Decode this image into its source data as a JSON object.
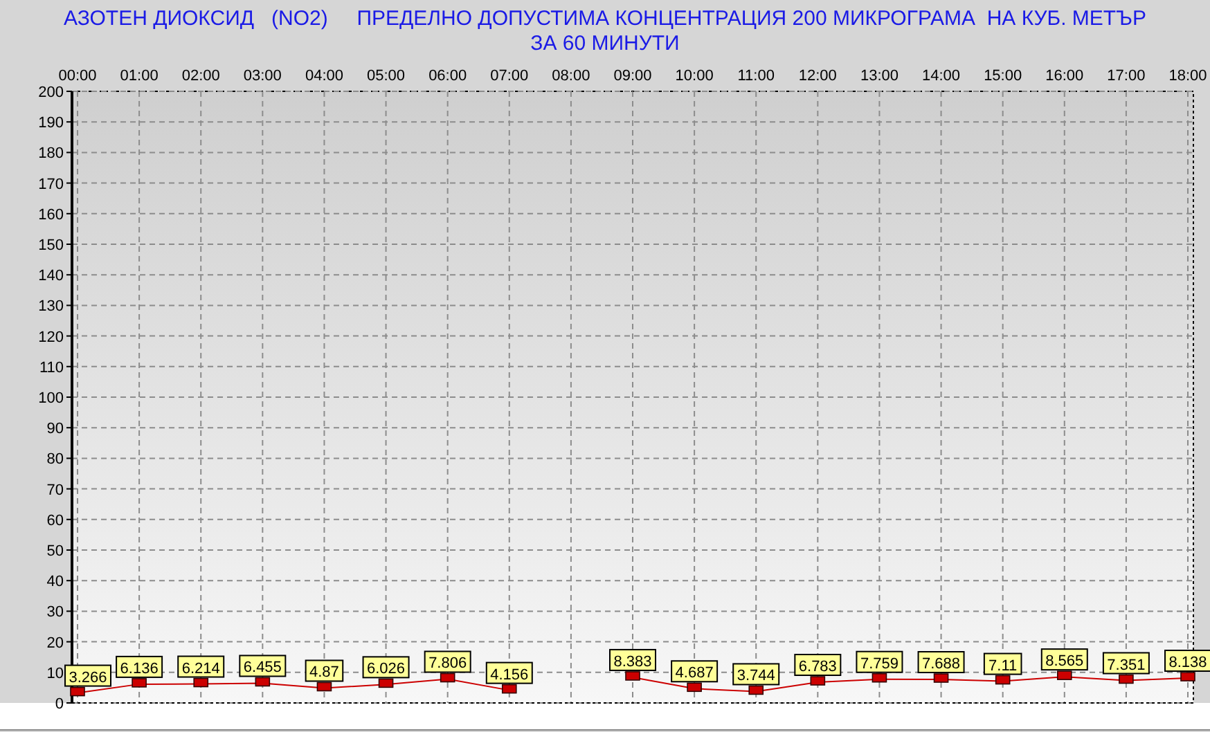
{
  "header": {
    "title": "АЗОТЕН ДИОКСИД   (NO2)     ПРЕДЕЛНО ДОПУСТИМА КОНЦЕНТРАЦИЯ 200 МИКРОГРАМА  НА КУБ. МЕТЪР",
    "subtitle": "ЗА 60 МИНУТИ"
  },
  "chart_data": {
    "type": "line",
    "categories": [
      "00:00",
      "01:00",
      "02:00",
      "03:00",
      "04:00",
      "05:00",
      "06:00",
      "07:00",
      "08:00",
      "09:00",
      "10:00",
      "11:00",
      "12:00",
      "13:00",
      "14:00",
      "15:00",
      "16:00",
      "17:00",
      "18:00"
    ],
    "grid": true,
    "series": [
      {
        "color": "#cc0000",
        "marker": "square",
        "values": [
          3.266,
          6.136,
          6.214,
          6.455,
          4.87,
          6.026,
          7.806,
          4.156,
          null,
          8.383,
          4.687,
          3.744,
          6.783,
          7.759,
          7.688,
          7.11,
          8.565,
          7.351,
          8.138
        ]
      }
    ],
    "ylim": [
      0,
      200
    ],
    "yticks": [
      0,
      10,
      20,
      30,
      40,
      50,
      60,
      70,
      80,
      90,
      100,
      110,
      120,
      130,
      140,
      150,
      160,
      170,
      180,
      190,
      200
    ],
    "data_labels": true
  }
}
